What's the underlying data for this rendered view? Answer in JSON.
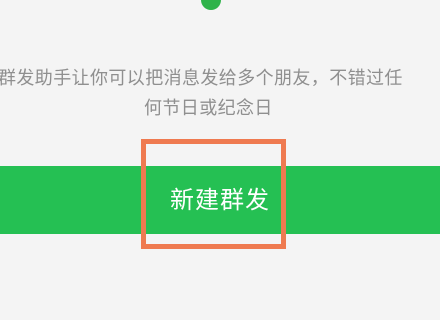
{
  "description": {
    "line1": "群发助手让你可以把消息发给多个朋友，不错过任",
    "line2": "何节日或纪念日"
  },
  "actions": {
    "new_broadcast_label": "新建群发"
  },
  "colors": {
    "background": "#f4f4f4",
    "primary": "#25c053",
    "highlight": "#ef7a50",
    "muted_text": "#8f8f8f",
    "button_text": "#ffffff"
  },
  "icons": {
    "top": "green-status-icon"
  }
}
